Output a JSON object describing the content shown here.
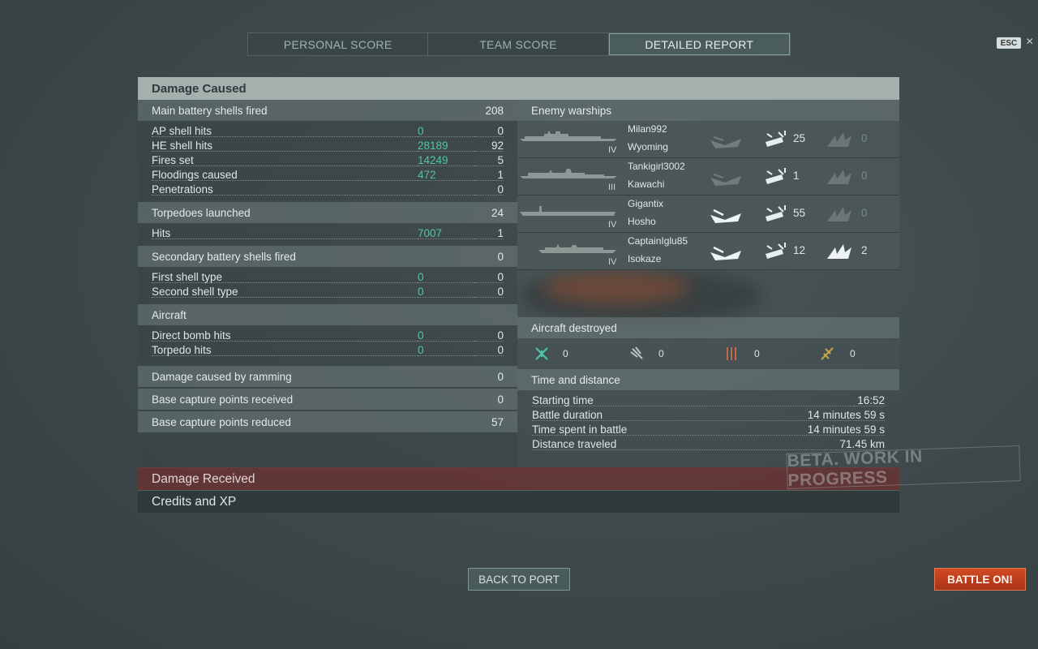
{
  "tabs": [
    {
      "label": "PERSONAL SCORE"
    },
    {
      "label": "TEAM SCORE"
    },
    {
      "label": "DETAILED REPORT"
    }
  ],
  "esc_label": "ESC",
  "close_glyph": "×",
  "panel": {
    "title": "Damage Caused",
    "main_battery": {
      "label": "Main battery shells fired",
      "value": "208",
      "rows": [
        {
          "label": "AP shell hits",
          "damage": "0",
          "value": "0"
        },
        {
          "label": "HE shell hits",
          "damage": "28189",
          "value": "92"
        },
        {
          "label": "Fires set",
          "damage": "14249",
          "value": "5"
        },
        {
          "label": "Floodings caused",
          "damage": "472",
          "value": "1"
        },
        {
          "label": "Penetrations",
          "damage": "",
          "value": "0"
        }
      ]
    },
    "torpedoes": {
      "label": "Torpedoes launched",
      "value": "24",
      "rows": [
        {
          "label": "Hits",
          "damage": "7007",
          "value": "1"
        }
      ]
    },
    "secondary": {
      "label": "Secondary battery shells fired",
      "value": "0",
      "rows": [
        {
          "label": "First shell type",
          "damage": "0",
          "value": "0"
        },
        {
          "label": "Second shell type",
          "damage": "0",
          "value": "0"
        }
      ]
    },
    "aircraft": {
      "label": "Aircraft",
      "rows": [
        {
          "label": "Direct bomb hits",
          "damage": "0",
          "value": "0"
        },
        {
          "label": "Torpedo hits",
          "damage": "0",
          "value": "0"
        }
      ]
    },
    "ramming": {
      "label": "Damage caused by ramming",
      "value": "0"
    },
    "capture_received": {
      "label": "Base capture points received",
      "value": "0"
    },
    "capture_reduced": {
      "label": "Base capture points reduced",
      "value": "57"
    },
    "enemy_warships": {
      "label": "Enemy warships",
      "ships": [
        {
          "player": "Milan992",
          "ship": "Wyoming",
          "tier": "IV",
          "sunk": false,
          "hits": "25",
          "fires": "0",
          "fires_active": false
        },
        {
          "player": "Tankigirl3002",
          "ship": "Kawachi",
          "tier": "III",
          "sunk": false,
          "hits": "1",
          "fires": "0",
          "fires_active": false
        },
        {
          "player": "Gigantix",
          "ship": "Hosho",
          "tier": "IV",
          "sunk": true,
          "hits": "55",
          "fires": "0",
          "fires_active": false
        },
        {
          "player": "CaptainIglu85",
          "ship": "Isokaze",
          "tier": "IV",
          "sunk": true,
          "hits": "12",
          "fires": "2",
          "fires_active": true
        }
      ]
    },
    "aircraft_destroyed": {
      "label": "Aircraft destroyed",
      "counts": [
        {
          "icon": "fighter-icon",
          "value": "0"
        },
        {
          "icon": "torpedo-bomber-icon",
          "value": "0"
        },
        {
          "icon": "dive-bomber-icon",
          "value": "0"
        },
        {
          "icon": "scout-plane-icon",
          "value": "0"
        }
      ]
    },
    "time_distance": {
      "label": "Time and distance",
      "rows": [
        {
          "label": "Starting time",
          "value": "16:52"
        },
        {
          "label": "Battle duration",
          "value": "14 minutes 59 s"
        },
        {
          "label": "Time spent in battle",
          "value": "14 minutes 59 s"
        },
        {
          "label": "Distance traveled",
          "value": "71.45 km"
        }
      ]
    },
    "damage_received": "Damage Received",
    "credits_xp": "Credits and XP"
  },
  "watermark": "BETA. WORK IN PROGRESS",
  "buttons": {
    "back": "BACK TO PORT",
    "battle": "BATTLE ON!"
  },
  "colors": {
    "accent_green": "#52c3a7",
    "battle_orange": "#c53f1e"
  }
}
